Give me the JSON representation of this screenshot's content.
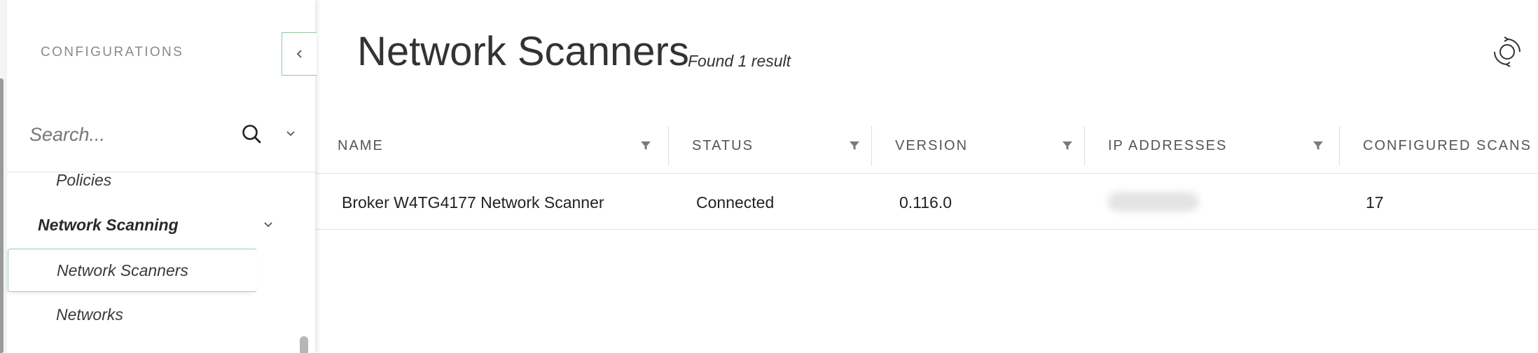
{
  "sidebar": {
    "heading": "CONFIGURATIONS",
    "collapse_icon": "chevron-left-icon",
    "search": {
      "placeholder": "Search...",
      "value": ""
    },
    "items": [
      {
        "label": "Policies"
      },
      {
        "label": "Network Scanning",
        "expanded": true
      },
      {
        "label": "Network Scanners",
        "selected": true
      },
      {
        "label": "Networks"
      }
    ]
  },
  "main": {
    "title": "Network Scanners",
    "result_count": "Found 1 result",
    "refresh_icon": "refresh-icon"
  },
  "table": {
    "columns": [
      "NAME",
      "STATUS",
      "VERSION",
      "IP ADDRESSES",
      "CONFIGURED SCANS"
    ],
    "rows": [
      {
        "name": "Broker W4TG4177 Network Scanner",
        "status": "Connected",
        "version": "0.116.0",
        "ip_addresses": "",
        "configured_scans": "17"
      }
    ]
  },
  "colors": {
    "accent": "#8fc89f",
    "text": "#2f2f2f",
    "muted": "#8a8a8a"
  }
}
